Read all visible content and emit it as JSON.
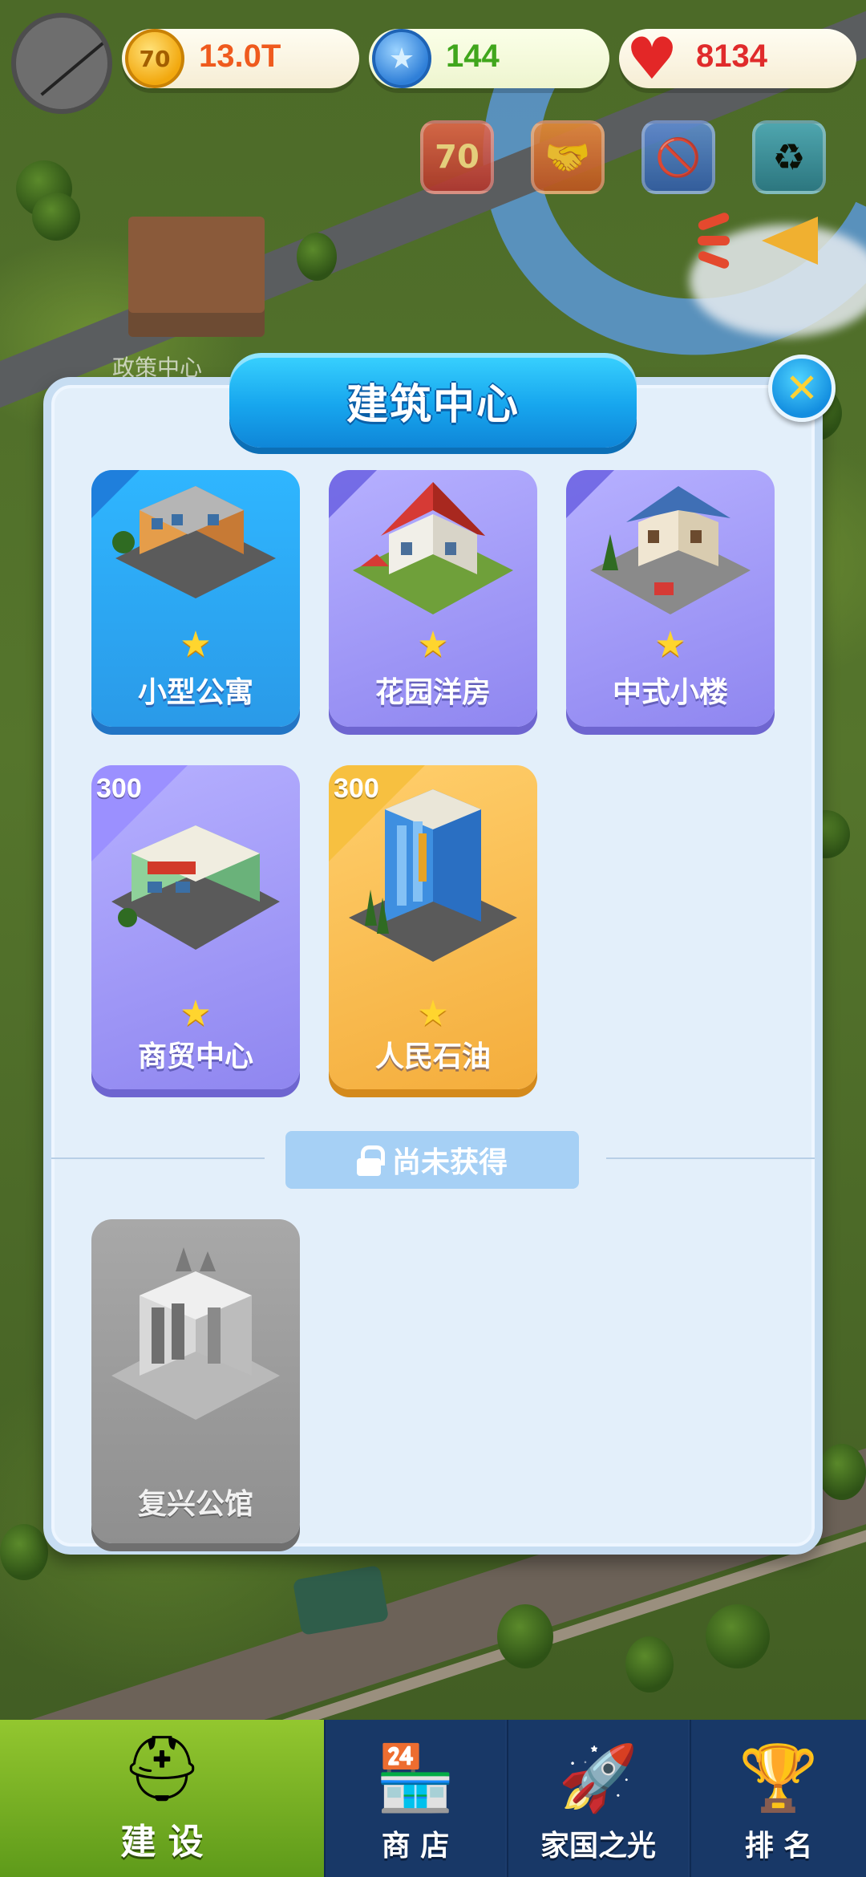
{
  "hud": {
    "gold": "13.0T",
    "gold_icon_text": "70",
    "stars": "144",
    "hearts": "8134",
    "event_badge_text": "70",
    "colors": {
      "gold": "#ef5a1d",
      "stars": "#40a61c",
      "hearts": "#e02b2b"
    }
  },
  "background": {
    "policy_center_label": "政策中心"
  },
  "modal": {
    "title": "建筑中心",
    "close_icon": "close-icon",
    "owned": [
      {
        "name": "小型公寓",
        "theme": "blue",
        "price": ""
      },
      {
        "name": "花园洋房",
        "theme": "purple",
        "price": ""
      },
      {
        "name": "中式小楼",
        "theme": "purple",
        "price": ""
      },
      {
        "name": "商贸中心",
        "theme": "purple",
        "price": "300"
      },
      {
        "name": "人民石油",
        "theme": "gold",
        "price": "300"
      }
    ],
    "locked_label": "尚未获得",
    "locked": [
      {
        "name": "复兴公馆",
        "theme": "grey"
      }
    ]
  },
  "nav": {
    "items": [
      {
        "label": "建 设",
        "icon": "hardhat-icon",
        "active": true
      },
      {
        "label": "商 店",
        "icon": "shop-icon",
        "active": false
      },
      {
        "label": "家国之光",
        "icon": "rocket-icon",
        "active": false
      },
      {
        "label": "排 名",
        "icon": "ranking-icon",
        "active": false
      }
    ]
  }
}
